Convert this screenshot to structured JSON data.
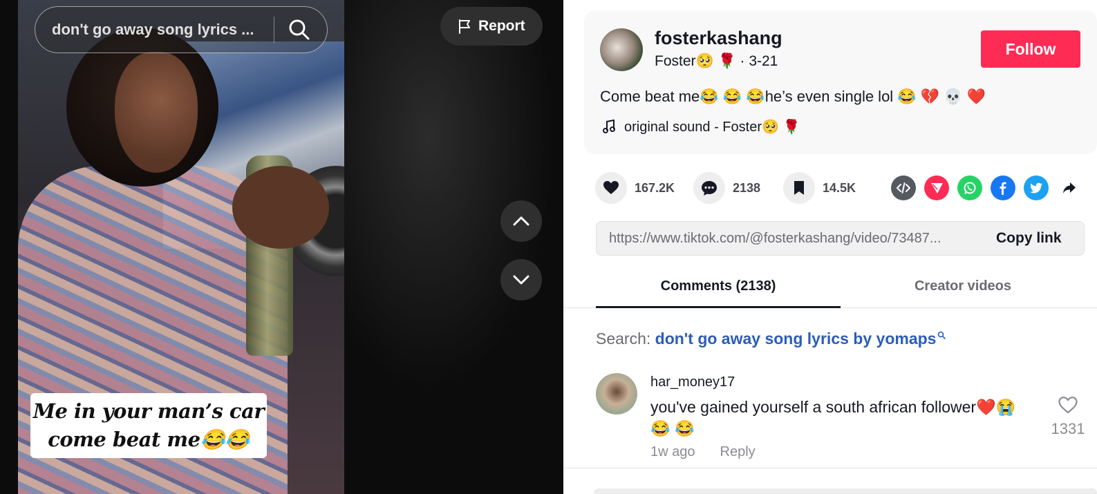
{
  "video": {
    "search_text": "don't go away song lyrics ...",
    "report_label": "Report",
    "caption_line1": "Me in your man’s car",
    "caption_line2": "come beat me😂😂"
  },
  "author": {
    "username": "fosterkashang",
    "nickname": "Foster🥺 🌹",
    "date": " · 3-21",
    "follow_label": "Follow"
  },
  "post": {
    "description": "Come beat me😂 😂 😂he’s even single lol  😂 💔 💀 ❤️",
    "music": "original sound - Foster🥺 🌹"
  },
  "stats": {
    "likes": "167.2K",
    "comments": "2138",
    "saves": "14.5K"
  },
  "share": {
    "link": "https://www.tiktok.com/@fosterkashang/video/73487...",
    "copy_label": "Copy link"
  },
  "tabs": {
    "comments": "Comments (2138)",
    "creator": "Creator videos"
  },
  "search_hint": {
    "label": "Search: ",
    "query": "don't go away song lyrics by yomaps"
  },
  "comments": [
    {
      "user": "har_money17",
      "text": "you've gained yourself a south african follower❤️😭 😂 😂",
      "time": "1w ago",
      "reply_label": "Reply",
      "likes": "1331"
    }
  ],
  "colors": {
    "follow": "#fe2c55",
    "link_query": "#2b5db9",
    "embed": "#555a60",
    "send": "#fe2c55",
    "whatsapp": "#25d366",
    "facebook": "#1877f2",
    "twitter": "#1da1f2"
  }
}
